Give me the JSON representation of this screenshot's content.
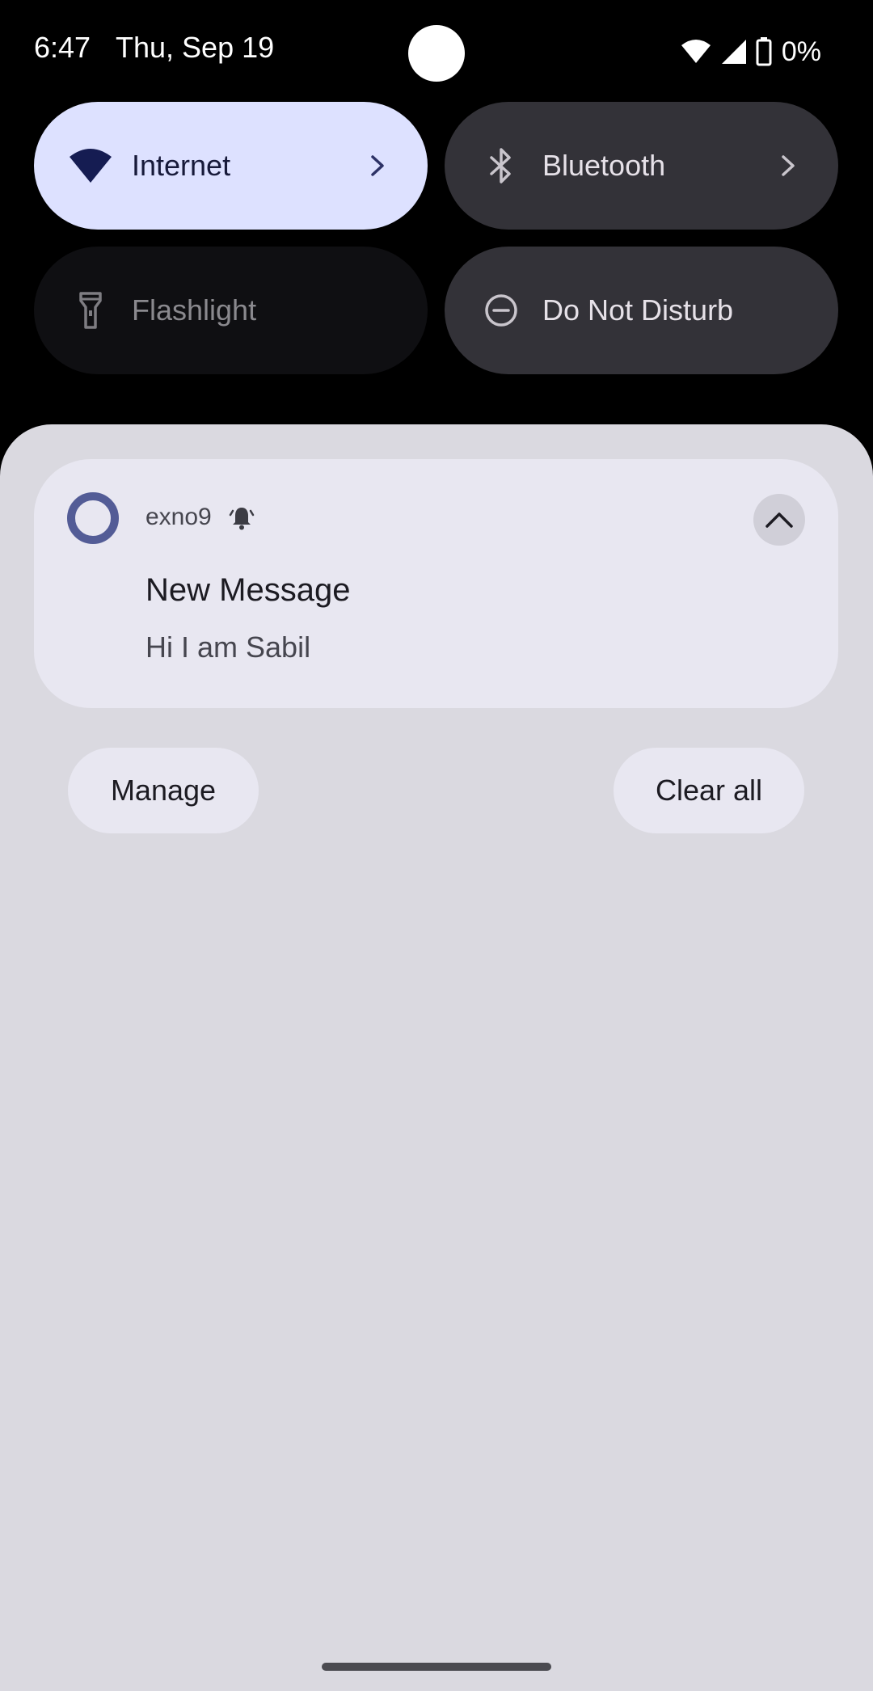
{
  "status_bar": {
    "time": "6:47",
    "date": "Thu, Sep 19",
    "battery": "0%",
    "icons": [
      "wifi-icon",
      "cell-signal-icon",
      "battery-icon"
    ]
  },
  "quick_settings": {
    "tiles": [
      {
        "label": "Internet",
        "icon": "wifi-icon",
        "state": "on",
        "has_chevron": true
      },
      {
        "label": "Bluetooth",
        "icon": "bluetooth-icon",
        "state": "off",
        "has_chevron": true
      },
      {
        "label": "Flashlight",
        "icon": "flashlight-icon",
        "state": "unavailable",
        "has_chevron": false
      },
      {
        "label": "Do Not Disturb",
        "icon": "do-not-disturb-icon",
        "state": "off",
        "has_chevron": false
      }
    ]
  },
  "notification": {
    "app_name": "exno9",
    "title": "New Message",
    "text": "Hi I am Sabil",
    "alert_icon": "bell-icon",
    "expand_icon": "chevron-up-icon"
  },
  "actions": {
    "manage_label": "Manage",
    "clear_all_label": "Clear all"
  },
  "colors": {
    "background": "#000000",
    "tile_active": "#dde1ff",
    "tile_inactive": "#333238",
    "tile_unavailable": "#0f0f12",
    "shade": "#dad9e0",
    "card": "#e8e7f1",
    "app_icon_accent": "#535c96"
  }
}
